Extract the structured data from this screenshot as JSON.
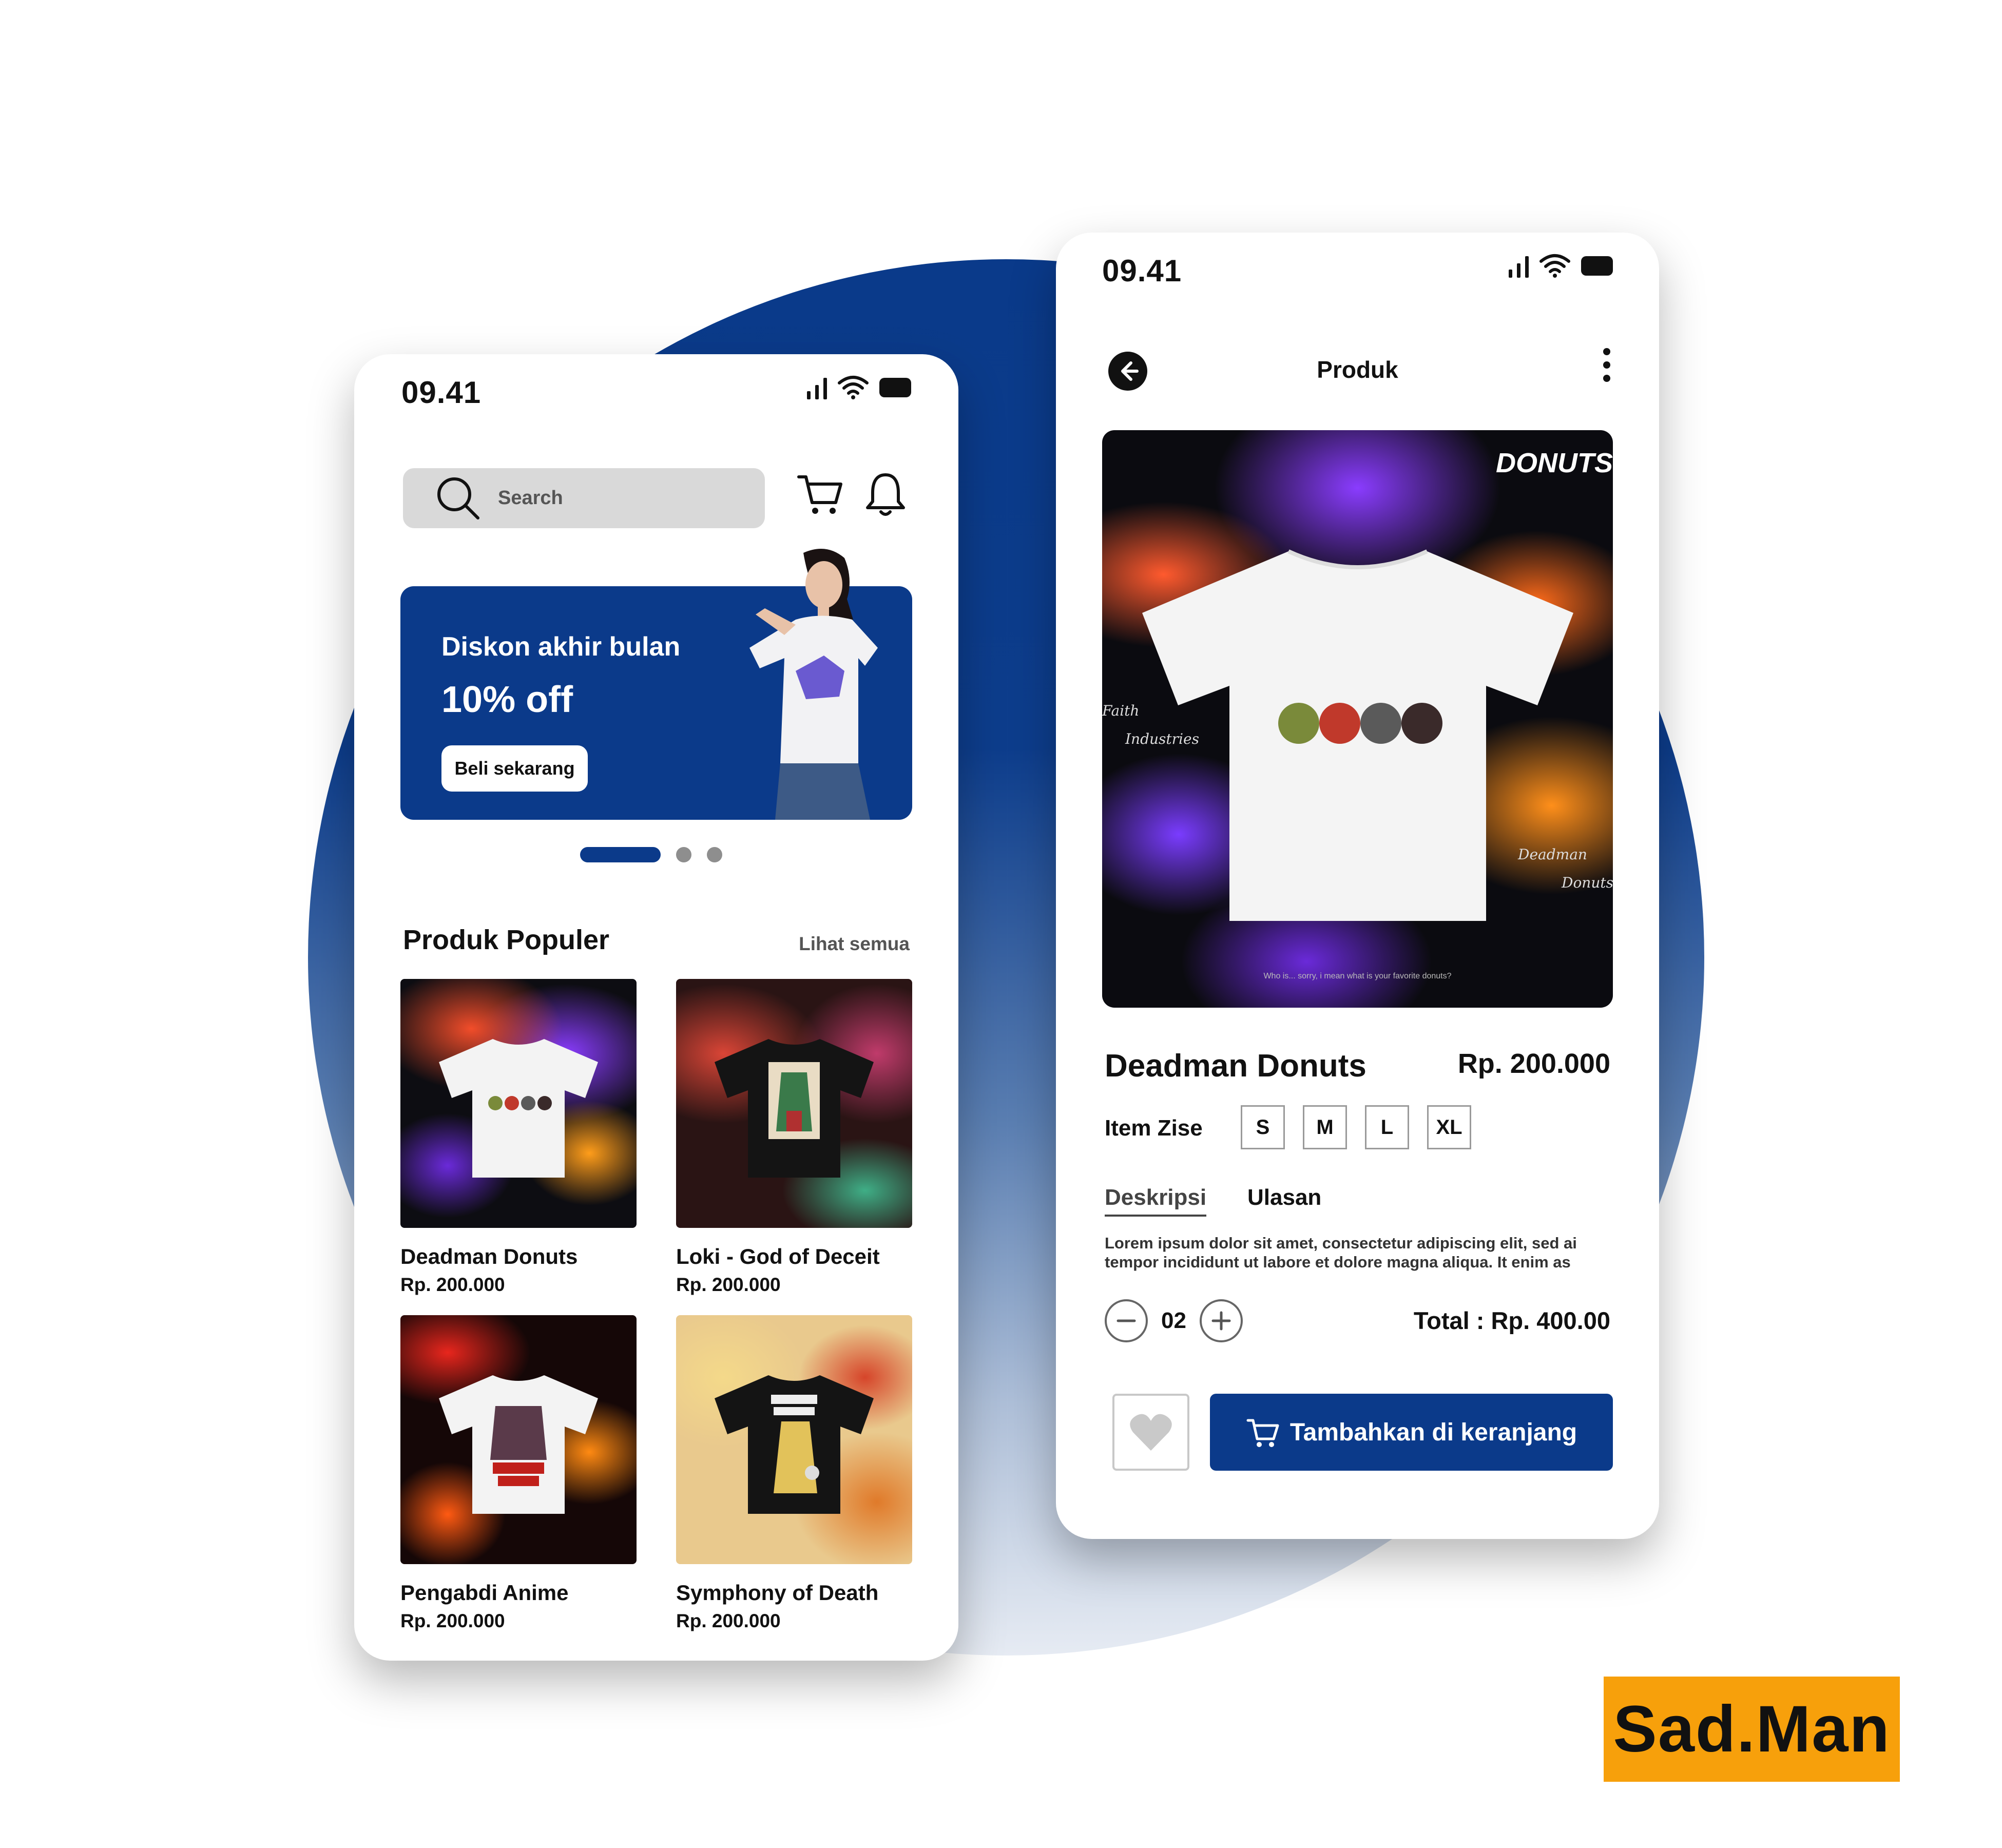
{
  "home": {
    "time": "09.41",
    "search": {
      "placeholder": "Search"
    },
    "banner": {
      "title": "Diskon akhir bulan",
      "discount": "10% off",
      "button": "Beli sekarang"
    },
    "carousel": {
      "pages": 3,
      "active_page": 1
    },
    "section": {
      "title": "Produk Populer",
      "link": "Lihat semua"
    },
    "products": [
      {
        "name": "Deadman Donuts",
        "price": "Rp. 200.000"
      },
      {
        "name": "Loki - God of Deceit",
        "price": "Rp. 200.000"
      },
      {
        "name": "Pengabdi Anime",
        "price": "Rp. 200.000"
      },
      {
        "name": "Symphony of Death",
        "price": "Rp. 200.000"
      }
    ]
  },
  "detail": {
    "time": "09.41",
    "title": "Produk",
    "hero": {
      "logo_line1": "DONUTS",
      "script_1": "Faith",
      "script_2": "Industries",
      "script_3": "Deadman",
      "script_4": "Donuts",
      "caption": "Who is... sorry, i mean what is your favorite donuts?"
    },
    "product_name": "Deadman Donuts",
    "price": "Rp. 200.000",
    "size_label": "Item Zise",
    "sizes": [
      "S",
      "M",
      "L",
      "XL"
    ],
    "tabs": {
      "description": "Deskripsi",
      "reviews": "Ulasan"
    },
    "description": "Lorem ipsum dolor sit amet, consectetur adipiscing elit, sed ai tempor incididunt ut labore et dolore magna aliqua. It enim as",
    "quantity": "02",
    "total": "Total : Rp. 400.00",
    "add_to_cart": "Tambahkan di keranjang"
  },
  "brand": "Sad.Man",
  "colors": {
    "primary": "#0b3a8a",
    "brand_badge": "#f7a00b"
  }
}
